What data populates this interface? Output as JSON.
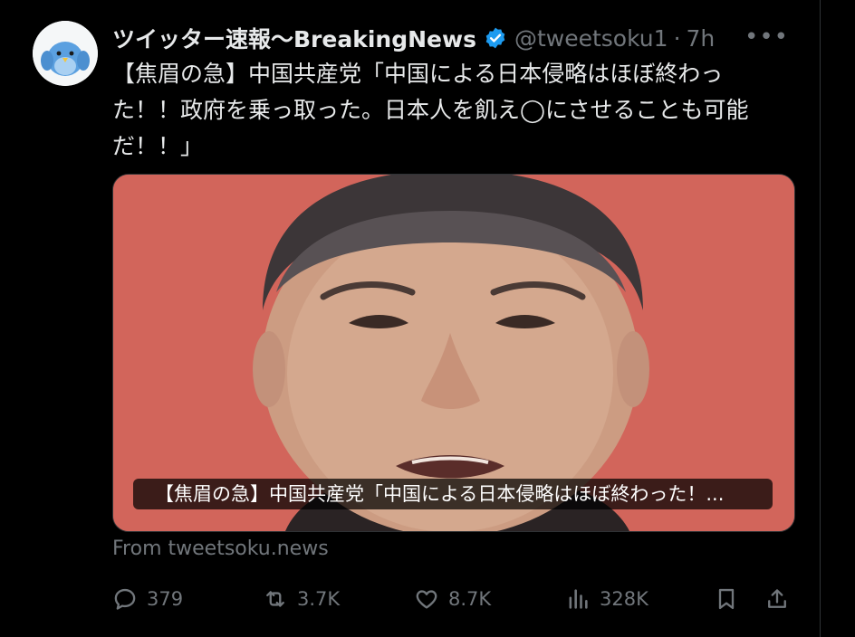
{
  "account": {
    "display_name": "ツイッター速報〜BreakingNews",
    "handle": "@tweetsoku1",
    "separator": "·",
    "time": "7h",
    "more_label": "•••"
  },
  "tweet": {
    "text": "【焦眉の急】中国共産党「中国による日本侵略はほぼ終わった！！政府を乗っ取った。日本人を飢え◯にさせることも可能だ！！」"
  },
  "card": {
    "caption": "【焦眉の急】中国共産党「中国による日本侵略はほぼ終わった！...",
    "source": "From tweetsoku.news"
  },
  "actions": {
    "replies": "379",
    "reposts": "3.7K",
    "likes": "8.7K",
    "views": "328K"
  },
  "colors": {
    "background": "#000000",
    "text": "#e7e9ea",
    "secondary": "#71767b",
    "verified": "#1d9bf0",
    "card_bg": "#d2655b"
  },
  "icons": [
    "bird-avatar-icon",
    "verified-badge-icon",
    "more-icon",
    "reply-icon",
    "repost-icon",
    "like-icon",
    "views-icon",
    "bookmark-icon",
    "share-icon"
  ]
}
